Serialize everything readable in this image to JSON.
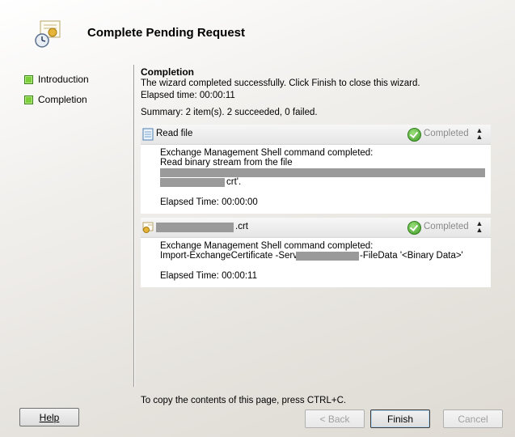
{
  "header": {
    "title": "Complete Pending Request"
  },
  "nav": {
    "items": [
      {
        "label": "Introduction"
      },
      {
        "label": "Completion"
      }
    ]
  },
  "completion": {
    "section_title": "Completion",
    "message": "The wizard completed successfully. Click Finish to close this wizard.",
    "elapsed": "Elapsed time: 00:00:11",
    "summary": "Summary: 2 item(s). 2 succeeded, 0 failed."
  },
  "steps": [
    {
      "title": "Read file",
      "status": "Completed",
      "line1": "Exchange Management Shell command completed:",
      "line2": "Read binary stream from the file",
      "line3_suffix": "crt'.",
      "elapsed": "Elapsed Time: 00:00:00"
    },
    {
      "title": ".crt",
      "status": "Completed",
      "line1": "Exchange Management Shell command completed:",
      "line2_prefix": "Import-ExchangeCertificate -Server",
      "line2_suffix": "-FileData '<Binary Data>'",
      "elapsed": "Elapsed Time: 00:00:11"
    }
  ],
  "footer": {
    "hint": "To copy the contents of this page, press CTRL+C.",
    "help_label": "Help",
    "back_label": "< Back",
    "finish_label": "Finish",
    "cancel_label": "Cancel"
  },
  "colors": {
    "nav_bullet": "#7ccf3a",
    "status_green": "#3d9b27",
    "redaction": "#9a9a9a"
  }
}
